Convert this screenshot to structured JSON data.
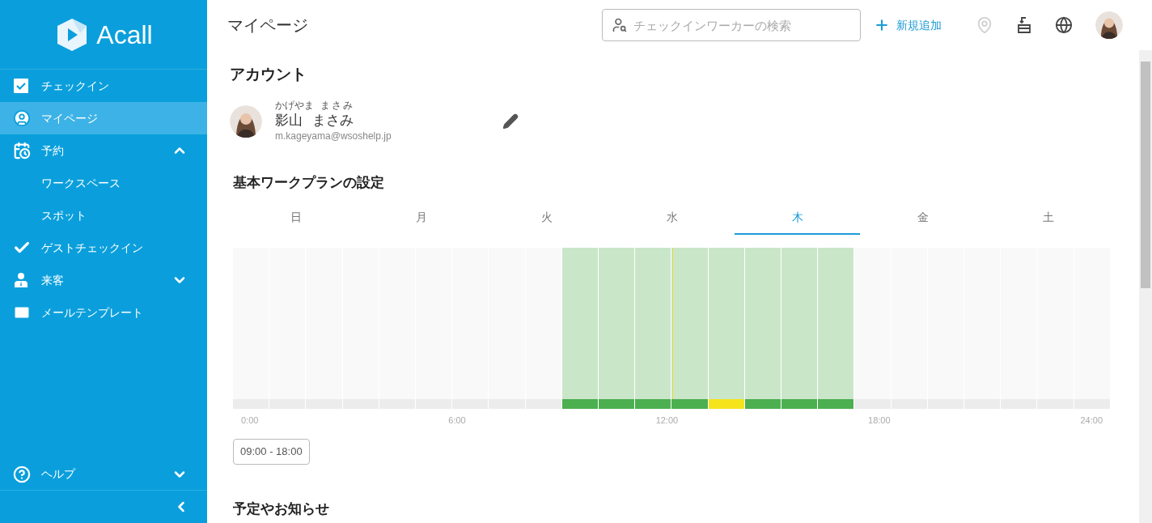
{
  "sidebar": {
    "logo": "Acall",
    "items": [
      {
        "label": "チェックイン",
        "kind": "item",
        "selected": false
      },
      {
        "label": "マイページ",
        "kind": "item",
        "selected": true
      },
      {
        "label": "予約",
        "kind": "group",
        "selected": false,
        "expanded": true,
        "children": [
          {
            "label": "ワークスペース",
            "selected": false
          },
          {
            "label": "スポット",
            "selected": false
          }
        ]
      },
      {
        "label": "ゲストチェックイン",
        "kind": "item",
        "selected": false
      },
      {
        "label": "来客",
        "kind": "group",
        "selected": false,
        "expanded": false
      },
      {
        "label": "メールテンプレート",
        "kind": "item",
        "selected": false
      }
    ],
    "help": {
      "label": "ヘルプ",
      "expanded": false
    }
  },
  "header": {
    "title": "マイページ",
    "search": {
      "placeholder": "チェックインワーカーの検索"
    },
    "add_button": "新規追加"
  },
  "account": {
    "heading": "アカウント",
    "name_reading": [
      "かげやま",
      "まさみ"
    ],
    "name": [
      "影山",
      "まさみ"
    ],
    "email": "m.kageyama@wsoshelp.jp"
  },
  "work_plan": {
    "heading": "基本ワークプランの設定",
    "tabs": [
      {
        "label": "日",
        "selected": false
      },
      {
        "label": "月",
        "selected": false
      },
      {
        "label": "火",
        "selected": false
      },
      {
        "label": "水",
        "selected": false
      },
      {
        "label": "木",
        "selected": true
      },
      {
        "label": "金",
        "selected": false
      },
      {
        "label": "土",
        "selected": false
      }
    ],
    "hours": [
      {
        "kind": "off"
      },
      {
        "kind": "off"
      },
      {
        "kind": "off"
      },
      {
        "kind": "off"
      },
      {
        "kind": "off"
      },
      {
        "kind": "off"
      },
      {
        "kind": "off"
      },
      {
        "kind": "off"
      },
      {
        "kind": "off"
      },
      {
        "kind": "work"
      },
      {
        "kind": "work"
      },
      {
        "kind": "work"
      },
      {
        "kind": "work"
      },
      {
        "kind": "break"
      },
      {
        "kind": "work"
      },
      {
        "kind": "work"
      },
      {
        "kind": "work"
      },
      {
        "kind": "off"
      },
      {
        "kind": "off"
      },
      {
        "kind": "off"
      },
      {
        "kind": "off"
      },
      {
        "kind": "off"
      },
      {
        "kind": "off"
      },
      {
        "kind": "off"
      }
    ],
    "now_line": {
      "level": 0.5
    },
    "axis_labels": [
      "0:00",
      "6:00",
      "12:00",
      "18:00",
      "24:00"
    ],
    "range_button": "09:00 - 18:00"
  },
  "notices": {
    "heading": "予定やお知らせ"
  }
}
